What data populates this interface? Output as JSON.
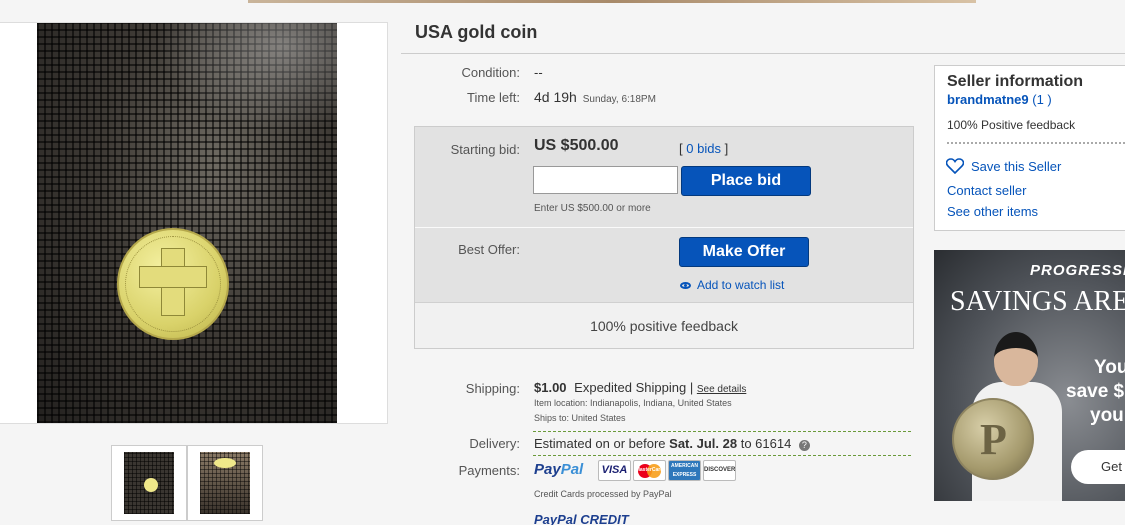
{
  "listing": {
    "title": "USA gold coin",
    "condition_label": "Condition:",
    "condition_value": "--",
    "time_left_label": "Time left:",
    "time_left_value": "4d 19h",
    "time_left_end": "Sunday, 6:18PM"
  },
  "bid": {
    "starting_label": "Starting bid:",
    "price": "US $500.00",
    "bids_link": "0 bids",
    "bids_open": "[",
    "bids_close": "]",
    "input_value": "",
    "hint": "Enter US $500.00 or more",
    "place_bid_label": "Place bid",
    "best_offer_label": "Best Offer:",
    "make_offer_label": "Make Offer",
    "watch_label": "Add to watch list",
    "feedback": "100% positive feedback"
  },
  "shipping": {
    "label": "Shipping:",
    "cost": "$1.00",
    "method": "Expedited Shipping",
    "sep": "|",
    "details_link": "See details",
    "item_location": "Item location:  Indianapolis, Indiana, United States",
    "ships_to": "Ships to:  United States"
  },
  "delivery": {
    "label": "Delivery:",
    "prefix": "Estimated on or before",
    "date": "Sat. Jul. 28",
    "to": "to 61614"
  },
  "payments": {
    "label": "Payments:",
    "paypal_a": "Pay",
    "paypal_b": "Pal",
    "cards": [
      "VISA",
      "MasterCard",
      "AMERICAN EXPRESS",
      "DISCOVER"
    ],
    "processed_note": "Credit Cards processed by PayPal",
    "credit_a": "PayPal",
    "credit_b": "CREDIT"
  },
  "seller": {
    "heading": "Seller information",
    "name": "brandmatne9",
    "score": "(1 )",
    "positive": "100% Positive feedback",
    "save_label": "Save this Seller",
    "contact_label": "Contact seller",
    "other_label": "See other items"
  },
  "ad": {
    "brand": "PROGRESSIVE",
    "headline": "SAVINGS ARE",
    "body_1": "You",
    "body_2": "save $",
    "body_3": "you",
    "cta": "Get",
    "coin_letter": "P"
  },
  "colors": {
    "link": "#0654ba",
    "button": "#0654ba"
  }
}
